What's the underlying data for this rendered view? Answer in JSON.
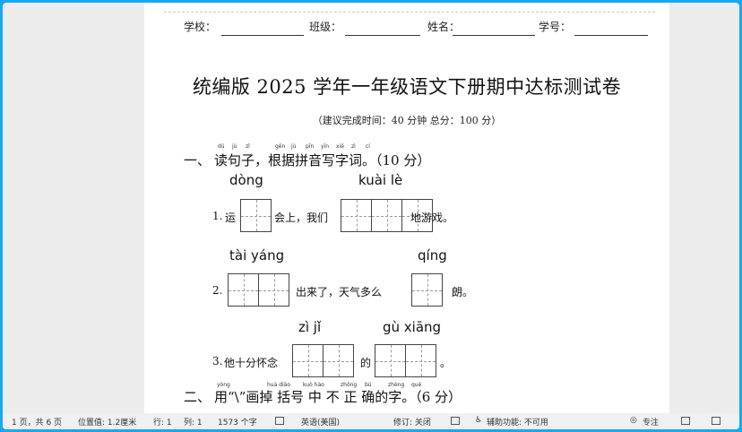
{
  "header": {
    "school": "学校：",
    "class": "班级：",
    "name": "姓名：",
    "number": "学号："
  },
  "title": "统编版 2025 学年一年级语文下册期中达标测试卷",
  "subtitle": "（建议完成时间：40 分钟  总分：100 分）",
  "section1": {
    "number": "一、",
    "heading": "读句子，根据拼音写字词。（10 分）",
    "pinyin_small": [
      "dú",
      "jù",
      "zǐ",
      "gēn",
      "jù",
      "pīn",
      "yīn",
      "xiě",
      "zì",
      "cí"
    ]
  },
  "q1": {
    "py1": "dòng",
    "py2": "kuài lè",
    "num": "1.",
    "t1": "运",
    "t2": "会上，我们",
    "t3": "地游戏。"
  },
  "q2": {
    "py1": "tài yáng",
    "py2": "qíng",
    "num": "2.",
    "t1": "出来了，天气多么",
    "t2": "朗。"
  },
  "q3": {
    "py1": "zì  jǐ",
    "py2": "gù xiāng",
    "num": "3.",
    "t1": "他十分怀念",
    "t2": "的",
    "t3": "。"
  },
  "section2": {
    "number": "二、",
    "heading": "用“\\”画掉 括号 中 不 正 确的字。（6 分）",
    "pinyin_small": [
      "yòng",
      "huà diào",
      "kuò hào",
      "zhōng",
      "bú",
      "zhèng",
      "què"
    ]
  },
  "statusbar": {
    "page": "1 页，共 6 页",
    "position": "位置值: 1.2厘米",
    "row": "行: 1",
    "col": "列: 1",
    "chars": "1573 个字",
    "lang": "英语(美国)",
    "revision": "修订: 关闭",
    "accessibility": "辅助功能: 不可用",
    "focus": "专注"
  }
}
